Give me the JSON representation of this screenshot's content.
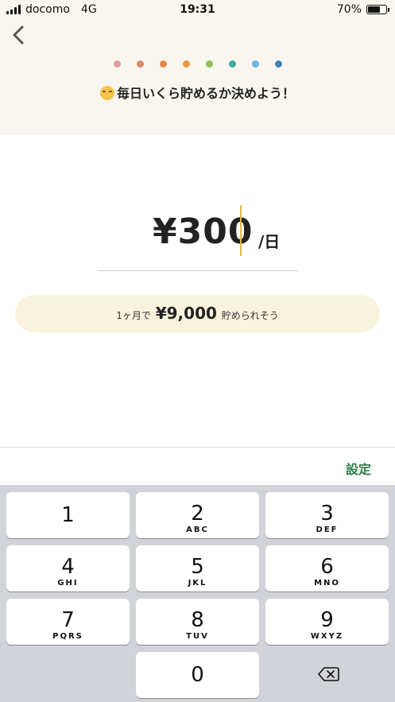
{
  "status": {
    "carrier": "docomo",
    "network": "4G",
    "time": "19:31",
    "battery": "70%",
    "battery_level": 0.7
  },
  "header": {
    "title": "毎日いくら貯めるか決めよう！",
    "dots": [
      "#e39aa5",
      "#e0886e",
      "#e38b4f",
      "#e39a45",
      "#8fbb5a",
      "#3eab9d",
      "#6fb2e0",
      "#3f82b8"
    ]
  },
  "amount": {
    "value": "¥300",
    "unit": "/日"
  },
  "estimate": {
    "prefix": "1ヶ月で",
    "value": "¥9,000",
    "suffix": "貯められそう"
  },
  "toolbar": {
    "set_label": "設定"
  },
  "keypad": {
    "keys": [
      {
        "num": "1",
        "letters": ""
      },
      {
        "num": "2",
        "letters": "ABC"
      },
      {
        "num": "3",
        "letters": "DEF"
      },
      {
        "num": "4",
        "letters": "GHI"
      },
      {
        "num": "5",
        "letters": "JKL"
      },
      {
        "num": "6",
        "letters": "MNO"
      },
      {
        "num": "7",
        "letters": "PQRS"
      },
      {
        "num": "8",
        "letters": "TUV"
      },
      {
        "num": "9",
        "letters": "WXYZ"
      },
      {
        "num": "0",
        "letters": ""
      }
    ]
  },
  "colors": {
    "accent": "#2e7d4a",
    "caret": "#e7b84a",
    "header_bg": "#f8f6ef",
    "estimate_bg": "#f8f3dc"
  }
}
